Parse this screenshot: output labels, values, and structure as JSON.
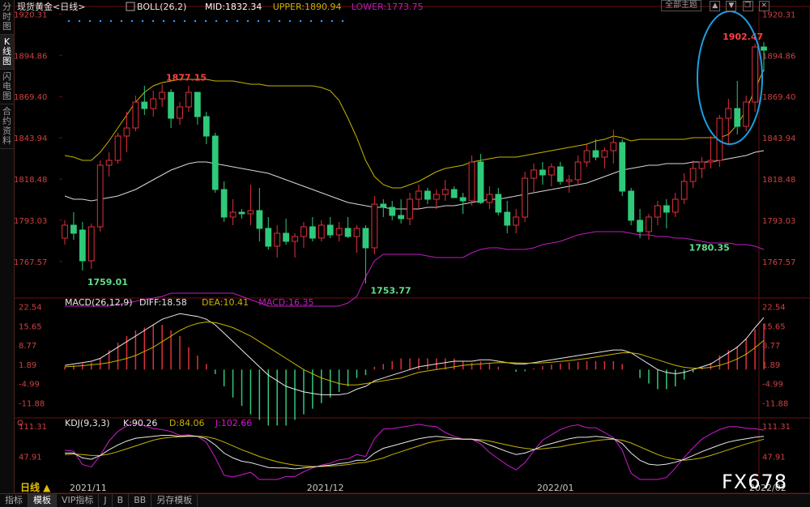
{
  "side_tabs": [
    "分时图",
    "K线图",
    "闪电图",
    "合约资料"
  ],
  "top_right": {
    "theme_label": "全部主题",
    "icons": [
      "toolbar-up-icon",
      "toolbar-down-icon",
      "toolbar-restore-icon",
      "toolbar-close-icon"
    ]
  },
  "bottom_tabs": [
    "指标",
    "模板",
    "VIP指标",
    "J",
    "B",
    "BB",
    "另存模板"
  ],
  "watermark": "FX678",
  "colors": {
    "up": "#e0303a",
    "down": "#2fc97a",
    "boll_mid": "#d8d8d8",
    "boll_upper": "#c8b400",
    "boll_lower": "#c01bc0",
    "macd_diff": "#e8e8e8",
    "macd_dea": "#c8b400",
    "kdj_k": "#e8e8e8",
    "kdj_d": "#c8b400",
    "kdj_j": "#d01bd0",
    "highlight": "#1aa0e0"
  },
  "chart_data": [
    {
      "type": "candlestick",
      "title_label": "现货黄金<日线>",
      "indicator_label": "BOLL(26,2)",
      "legend": [
        {
          "name": "MID",
          "value": "1832.34",
          "color": "#ffffff"
        },
        {
          "name": "UPPER",
          "value": "1890.94",
          "color": "#c8b400"
        },
        {
          "name": "LOWER",
          "value": "1773.75",
          "color": "#c01bc0"
        }
      ],
      "ylim": [
        1745,
        1925
      ],
      "y_ticks": [
        "1920.31",
        "1894.86",
        "1869.40",
        "1843.94",
        "1818.48",
        "1793.03",
        "1767.57"
      ],
      "x_labels": [
        "2021/11",
        "2021/12",
        "2022/01",
        "2022/02"
      ],
      "period_label": "日线",
      "annotations": [
        {
          "text": "1759.01"
        },
        {
          "text": "1877.15"
        },
        {
          "text": "1753.77"
        },
        {
          "text": "1780.35"
        },
        {
          "text": "1902.47"
        }
      ],
      "ohlc": [
        [
          1782,
          1793,
          1778,
          1790
        ],
        [
          1790,
          1798,
          1781,
          1785
        ],
        [
          1787,
          1792,
          1762,
          1768
        ],
        [
          1768,
          1791,
          1763,
          1789
        ],
        [
          1789,
          1830,
          1786,
          1827
        ],
        [
          1827,
          1835,
          1820,
          1830
        ],
        [
          1830,
          1847,
          1828,
          1845
        ],
        [
          1845,
          1860,
          1835,
          1850
        ],
        [
          1850,
          1870,
          1848,
          1866
        ],
        [
          1866,
          1876,
          1858,
          1862
        ],
        [
          1862,
          1873,
          1857,
          1868
        ],
        [
          1868,
          1877,
          1863,
          1872
        ],
        [
          1872,
          1874,
          1850,
          1856
        ],
        [
          1856,
          1866,
          1852,
          1863
        ],
        [
          1863,
          1876,
          1860,
          1872
        ],
        [
          1872,
          1872,
          1852,
          1857
        ],
        [
          1857,
          1860,
          1840,
          1845
        ],
        [
          1845,
          1847,
          1810,
          1812
        ],
        [
          1812,
          1817,
          1792,
          1795
        ],
        [
          1795,
          1806,
          1790,
          1798
        ],
        [
          1798,
          1800,
          1794,
          1797
        ],
        [
          1797,
          1815,
          1790,
          1799
        ],
        [
          1799,
          1813,
          1780,
          1788
        ],
        [
          1788,
          1795,
          1775,
          1777
        ],
        [
          1777,
          1790,
          1770,
          1785
        ],
        [
          1785,
          1794,
          1778,
          1780
        ],
        [
          1780,
          1785,
          1770,
          1783
        ],
        [
          1783,
          1792,
          1776,
          1789
        ],
        [
          1789,
          1795,
          1780,
          1782
        ],
        [
          1782,
          1793,
          1780,
          1790
        ],
        [
          1790,
          1795,
          1782,
          1784
        ],
        [
          1784,
          1792,
          1780,
          1788
        ],
        [
          1788,
          1795,
          1782,
          1783
        ],
        [
          1783,
          1790,
          1773,
          1788
        ],
        [
          1788,
          1790,
          1754,
          1776
        ],
        [
          1776,
          1808,
          1772,
          1803
        ],
        [
          1803,
          1806,
          1795,
          1801
        ],
        [
          1801,
          1805,
          1793,
          1796
        ],
        [
          1796,
          1806,
          1791,
          1794
        ],
        [
          1794,
          1810,
          1790,
          1806
        ],
        [
          1806,
          1815,
          1800,
          1811
        ],
        [
          1811,
          1813,
          1803,
          1806
        ],
        [
          1806,
          1812,
          1800,
          1809
        ],
        [
          1809,
          1818,
          1805,
          1812
        ],
        [
          1812,
          1814,
          1807,
          1807
        ],
        [
          1807,
          1810,
          1797,
          1805
        ],
        [
          1805,
          1833,
          1802,
          1829
        ],
        [
          1829,
          1834,
          1803,
          1804
        ],
        [
          1804,
          1814,
          1800,
          1809
        ],
        [
          1809,
          1813,
          1796,
          1798
        ],
        [
          1798,
          1805,
          1785,
          1790
        ],
        [
          1790,
          1800,
          1785,
          1795
        ],
        [
          1795,
          1823,
          1792,
          1819
        ],
        [
          1819,
          1828,
          1810,
          1824
        ],
        [
          1824,
          1829,
          1815,
          1821
        ],
        [
          1821,
          1828,
          1814,
          1826
        ],
        [
          1826,
          1829,
          1815,
          1817
        ],
        [
          1817,
          1821,
          1810,
          1818
        ],
        [
          1818,
          1833,
          1815,
          1829
        ],
        [
          1829,
          1840,
          1826,
          1836
        ],
        [
          1836,
          1843,
          1830,
          1832
        ],
        [
          1832,
          1838,
          1825,
          1836
        ],
        [
          1836,
          1849,
          1828,
          1841
        ],
        [
          1841,
          1843,
          1808,
          1811
        ],
        [
          1811,
          1813,
          1790,
          1793
        ],
        [
          1793,
          1800,
          1782,
          1786
        ],
        [
          1786,
          1797,
          1781,
          1795
        ],
        [
          1795,
          1805,
          1790,
          1802
        ],
        [
          1802,
          1806,
          1788,
          1798
        ],
        [
          1798,
          1810,
          1795,
          1806
        ],
        [
          1806,
          1822,
          1803,
          1817
        ],
        [
          1817,
          1830,
          1813,
          1825
        ],
        [
          1825,
          1832,
          1819,
          1829
        ],
        [
          1829,
          1845,
          1825,
          1830
        ],
        [
          1830,
          1858,
          1826,
          1856
        ],
        [
          1856,
          1868,
          1840,
          1862
        ],
        [
          1862,
          1879,
          1846,
          1851
        ],
        [
          1851,
          1870,
          1848,
          1866
        ],
        [
          1866,
          1902,
          1860,
          1900
        ],
        [
          1900,
          1903,
          1885,
          1898
        ]
      ],
      "boll_mid": [
        1808,
        1806,
        1806,
        1805,
        1806,
        1807,
        1808,
        1810,
        1812,
        1815,
        1818,
        1821,
        1824,
        1826,
        1828,
        1829,
        1829,
        1828,
        1827,
        1826,
        1825,
        1824,
        1823,
        1822,
        1820,
        1818,
        1816,
        1814,
        1812,
        1810,
        1808,
        1806,
        1804,
        1803,
        1802,
        1801,
        1801,
        1800,
        1800,
        1800,
        1800,
        1801,
        1801,
        1802,
        1802,
        1803,
        1804,
        1805,
        1806,
        1806,
        1807,
        1808,
        1809,
        1810,
        1811,
        1812,
        1813,
        1814,
        1815,
        1816,
        1818,
        1820,
        1822,
        1824,
        1825,
        1826,
        1827,
        1827,
        1828,
        1828,
        1828,
        1829,
        1829,
        1829,
        1830,
        1831,
        1832,
        1833,
        1835,
        1836
      ],
      "boll_upper": [
        1833,
        1832,
        1830,
        1830,
        1835,
        1842,
        1850,
        1858,
        1866,
        1872,
        1876,
        1878,
        1879,
        1880,
        1880,
        1880,
        1880,
        1879,
        1879,
        1879,
        1878,
        1877,
        1877,
        1876,
        1876,
        1876,
        1876,
        1876,
        1876,
        1875,
        1873,
        1867,
        1856,
        1844,
        1830,
        1820,
        1815,
        1813,
        1813,
        1815,
        1817,
        1820,
        1823,
        1825,
        1826,
        1827,
        1829,
        1830,
        1831,
        1832,
        1832,
        1832,
        1833,
        1834,
        1835,
        1836,
        1837,
        1838,
        1839,
        1840,
        1842,
        1843,
        1845,
        1844,
        1842,
        1843,
        1843,
        1843,
        1843,
        1843,
        1843,
        1844,
        1844,
        1844,
        1844,
        1846,
        1852,
        1861,
        1874,
        1886
      ],
      "boll_lower": [
        1740,
        1740,
        1740,
        1740,
        1740,
        1740,
        1741,
        1742,
        1743,
        1744,
        1745,
        1746,
        1748,
        1748,
        1748,
        1748,
        1748,
        1748,
        1748,
        1748,
        1746,
        1744,
        1742,
        1740,
        1740,
        1740,
        1740,
        1740,
        1740,
        1740,
        1740,
        1740,
        1742,
        1746,
        1758,
        1768,
        1772,
        1772,
        1772,
        1772,
        1772,
        1771,
        1770,
        1770,
        1770,
        1770,
        1773,
        1775,
        1776,
        1776,
        1775,
        1775,
        1775,
        1776,
        1778,
        1779,
        1780,
        1782,
        1784,
        1785,
        1786,
        1786,
        1786,
        1786,
        1785,
        1784,
        1784,
        1783,
        1783,
        1782,
        1782,
        1781,
        1780,
        1779,
        1779,
        1779,
        1778,
        1778,
        1777,
        1775
      ]
    },
    {
      "type": "bar_line",
      "indicator_label": "MACD(26,12,9)",
      "legend": [
        {
          "name": "DIFF",
          "value": "18.58",
          "color": "#e8e8e8"
        },
        {
          "name": "DEA",
          "value": "10.41",
          "color": "#c8b400"
        },
        {
          "name": "MACD",
          "value": "16.35",
          "color": "#c01bc0"
        }
      ],
      "ylim": [
        -17,
        25
      ],
      "y_ticks": [
        "22.54",
        "15.65",
        "8.77",
        "1.89",
        "-4.99",
        "-11.88"
      ],
      "diff": [
        1.5,
        2,
        2.5,
        3,
        4,
        6,
        8,
        10,
        12,
        14,
        16,
        18,
        19,
        20,
        19.5,
        19,
        18,
        16,
        13,
        10,
        7,
        4,
        1,
        -2,
        -4,
        -6,
        -7,
        -8,
        -8.5,
        -9,
        -9,
        -9,
        -8.5,
        -7,
        -6,
        -4,
        -3,
        -2,
        -1,
        0,
        1,
        1.5,
        2,
        2.5,
        3,
        3,
        3,
        3.5,
        3.5,
        3,
        2.5,
        2,
        2,
        2.5,
        3,
        3.5,
        4,
        4.5,
        5,
        5.5,
        6,
        6.5,
        7,
        7,
        6,
        4,
        2,
        0,
        -1,
        -1.5,
        -1,
        0,
        1,
        2,
        4,
        6,
        8,
        11,
        15,
        18.6
      ],
      "dea": [
        1,
        1.2,
        1.4,
        1.7,
        2,
        2.5,
        3.2,
        4,
        5,
        6.5,
        8,
        10,
        12,
        14,
        15.5,
        16.5,
        17,
        16.8,
        16,
        15,
        13.5,
        12,
        10,
        8,
        6,
        4,
        2,
        0,
        -1.5,
        -3,
        -4,
        -5,
        -5.5,
        -5.5,
        -5,
        -4.5,
        -4,
        -3.5,
        -3,
        -2,
        -1,
        -0.5,
        0,
        0.5,
        1,
        1.5,
        1.8,
        2,
        2.3,
        2.5,
        2.5,
        2.4,
        2.3,
        2.3,
        2.4,
        2.6,
        2.9,
        3.2,
        3.6,
        4,
        4.5,
        5,
        5.5,
        6,
        6,
        5.5,
        4.5,
        3.5,
        2.5,
        1.5,
        0.8,
        0.5,
        0.5,
        0.8,
        1.5,
        2.5,
        3.8,
        5.5,
        7.8,
        10.4
      ],
      "hist": [
        1,
        1.6,
        2.2,
        2.6,
        4,
        7,
        9.6,
        12,
        14,
        15,
        16,
        16,
        14,
        12,
        8,
        5,
        2,
        -1.6,
        -6,
        -10,
        -13,
        -16,
        -18,
        -20,
        -20,
        -20,
        -18,
        -16,
        -14,
        -12,
        -10,
        -8,
        -6,
        -3,
        -2,
        1,
        2,
        3,
        4,
        4,
        4,
        4,
        4,
        4,
        4,
        3,
        2.4,
        3,
        2.4,
        1,
        0,
        -0.8,
        -0.6,
        0.4,
        1.2,
        1.8,
        2.2,
        2.6,
        2.8,
        3,
        3,
        3,
        3,
        2,
        0,
        -3,
        -5,
        -7,
        -7,
        -6,
        -3.6,
        -1,
        1,
        2.4,
        5,
        7,
        8.4,
        11,
        14.4,
        16.35
      ]
    },
    {
      "type": "line",
      "indicator_label": "KDJ(9,3,3)",
      "legend": [
        {
          "name": "K",
          "value": "90.26",
          "color": "#e8e8e8"
        },
        {
          "name": "D",
          "value": "84.06",
          "color": "#c8b400"
        },
        {
          "name": "J",
          "value": "102.66",
          "color": "#d01bd0"
        }
      ],
      "ylim": [
        0,
        125
      ],
      "y_ticks": [
        "111.31",
        "47.91"
      ],
      "k": [
        55,
        55,
        45,
        42,
        50,
        62,
        72,
        80,
        86,
        88,
        90,
        92,
        92,
        90,
        91,
        90,
        85,
        72,
        55,
        45,
        38,
        35,
        30,
        25,
        24,
        24,
        22,
        24,
        26,
        28,
        30,
        33,
        35,
        40,
        40,
        55,
        65,
        70,
        75,
        80,
        85,
        88,
        90,
        88,
        86,
        84,
        84,
        80,
        72,
        65,
        58,
        52,
        55,
        62,
        70,
        75,
        80,
        85,
        88,
        88,
        90,
        88,
        85,
        75,
        55,
        40,
        32,
        30,
        32,
        36,
        42,
        50,
        58,
        65,
        72,
        78,
        82,
        85,
        88,
        90
      ],
      "d": [
        52,
        53,
        52,
        50,
        50,
        53,
        58,
        64,
        70,
        76,
        82,
        86,
        88,
        89,
        90,
        90,
        89,
        85,
        78,
        70,
        62,
        55,
        48,
        42,
        37,
        33,
        30,
        28,
        27,
        27,
        28,
        29,
        31,
        34,
        36,
        40,
        45,
        52,
        58,
        64,
        70,
        76,
        80,
        83,
        84,
        84,
        84,
        83,
        80,
        76,
        72,
        68,
        65,
        63,
        64,
        66,
        68,
        72,
        75,
        78,
        81,
        83,
        84,
        82,
        76,
        68,
        60,
        52,
        46,
        42,
        40,
        42,
        45,
        50,
        56,
        62,
        68,
        74,
        79,
        84
      ],
      "j": [
        61,
        59,
        31,
        26,
        50,
        80,
        100,
        112,
        118,
        112,
        106,
        104,
        100,
        92,
        93,
        90,
        77,
        46,
        9,
        5,
        10,
        15,
        0,
        0,
        0,
        6,
        6,
        16,
        24,
        30,
        34,
        41,
        43,
        52,
        48,
        85,
        105,
        106,
        109,
        112,
        115,
        112,
        110,
        98,
        90,
        84,
        84,
        74,
        56,
        43,
        30,
        20,
        35,
        60,
        82,
        93,
        104,
        111,
        114,
        108,
        108,
        98,
        87,
        61,
        13,
        0,
        0,
        0,
        4,
        24,
        46,
        66,
        84,
        95,
        104,
        110,
        110,
        107,
        106,
        102.66
      ]
    }
  ]
}
